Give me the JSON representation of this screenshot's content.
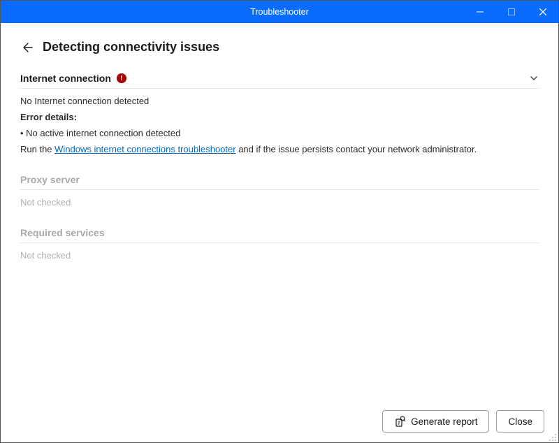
{
  "titlebar": {
    "title": "Troubleshooter"
  },
  "header": {
    "page_title": "Detecting connectivity issues"
  },
  "sections": {
    "internet": {
      "title": "Internet connection",
      "status_line": "No Internet connection detected",
      "error_header": "Error details:",
      "error_items": {
        "0": "No active internet connection detected"
      },
      "help_prefix": "Run the ",
      "help_link": "Windows internet connections troubleshooter",
      "help_suffix": " and if the issue persists contact your network administrator."
    },
    "proxy": {
      "title": "Proxy server",
      "status": "Not checked"
    },
    "services": {
      "title": "Required services",
      "status": "Not checked"
    }
  },
  "footer": {
    "generate_label": "Generate report",
    "close_label": "Close"
  },
  "badge": {
    "exclaim": "!"
  }
}
